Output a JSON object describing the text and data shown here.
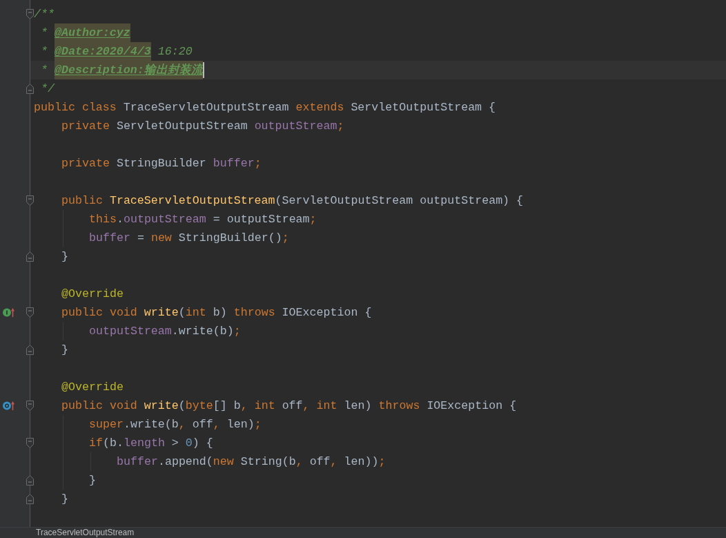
{
  "editor": {
    "lines": [
      {
        "current": false,
        "fold_marker": {
          "kind": "start"
        },
        "tokens": [
          {
            "kind": "doc",
            "text": "/**"
          }
        ]
      },
      {
        "current": false,
        "tokens": [
          {
            "kind": "doc",
            "text": " * "
          },
          {
            "kind": "doctag",
            "text": "@Author:cyz"
          }
        ]
      },
      {
        "current": false,
        "tokens": [
          {
            "kind": "doc",
            "text": " * "
          },
          {
            "kind": "doctag",
            "text": "@Date:2020/4/3"
          },
          {
            "kind": "doc",
            "text": " 16:20"
          }
        ]
      },
      {
        "current": true,
        "tokens": [
          {
            "kind": "doc",
            "text": " * "
          },
          {
            "kind": "doctag",
            "text": "@Description:输出封装流"
          }
        ]
      },
      {
        "current": false,
        "fold_marker": {
          "kind": "end"
        },
        "tokens": [
          {
            "kind": "doc",
            "text": " */"
          }
        ]
      },
      {
        "current": false,
        "tokens": [
          {
            "kind": "keyword",
            "text": "public class "
          },
          {
            "kind": "plain",
            "text": "TraceServletOutputStream "
          },
          {
            "kind": "keyword",
            "text": "extends "
          },
          {
            "kind": "plain",
            "text": "ServletOutputStream {"
          }
        ],
        "children": [
          {
            "current": false,
            "tokens": [
              {
                "kind": "keyword",
                "text": "private "
              },
              {
                "kind": "plain",
                "text": "ServletOutputStream "
              },
              {
                "kind": "field",
                "text": "outputStream"
              },
              {
                "kind": "punct",
                "text": ";"
              }
            ]
          },
          {
            "current": false
          },
          {
            "current": false,
            "tokens": [
              {
                "kind": "keyword",
                "text": "private "
              },
              {
                "kind": "plain",
                "text": "StringBuilder "
              },
              {
                "kind": "field",
                "text": "buffer"
              },
              {
                "kind": "punct",
                "text": ";"
              }
            ]
          },
          {
            "current": false
          },
          {
            "current": false,
            "fold_marker": {
              "kind": "start"
            },
            "tokens": [
              {
                "kind": "keyword",
                "text": "public "
              },
              {
                "kind": "decl",
                "text": "TraceServletOutputStream"
              },
              {
                "kind": "plain",
                "text": "(ServletOutputStream outputStream) {"
              }
            ],
            "children": [
              {
                "current": false,
                "tokens": [
                  {
                    "kind": "keyword",
                    "text": "this"
                  },
                  {
                    "kind": "plain",
                    "text": "."
                  },
                  {
                    "kind": "field",
                    "text": "outputStream"
                  },
                  {
                    "kind": "plain",
                    "text": " = outputStream"
                  },
                  {
                    "kind": "punct",
                    "text": ";"
                  }
                ]
              },
              {
                "current": false,
                "tokens": [
                  {
                    "kind": "field",
                    "text": "buffer"
                  },
                  {
                    "kind": "plain",
                    "text": " = "
                  },
                  {
                    "kind": "keyword",
                    "text": "new "
                  },
                  {
                    "kind": "plain",
                    "text": "StringBuilder()"
                  },
                  {
                    "kind": "punct",
                    "text": ";"
                  }
                ]
              }
            ]
          },
          {
            "current": false,
            "fold_marker": {
              "kind": "end"
            },
            "tokens": [
              {
                "kind": "plain",
                "text": "}"
              }
            ]
          },
          {
            "current": false
          },
          {
            "current": false,
            "tokens": [
              {
                "kind": "annotation",
                "text": "@Override"
              }
            ]
          },
          {
            "current": false,
            "gutter_icon": {
              "kind": "implements"
            },
            "fold_marker": {
              "kind": "start"
            },
            "tokens": [
              {
                "kind": "keyword",
                "text": "public void "
              },
              {
                "kind": "decl",
                "text": "write"
              },
              {
                "kind": "plain",
                "text": "("
              },
              {
                "kind": "keyword",
                "text": "int "
              },
              {
                "kind": "plain",
                "text": "b) "
              },
              {
                "kind": "keyword",
                "text": "throws "
              },
              {
                "kind": "plain",
                "text": "IOException {"
              }
            ],
            "children": [
              {
                "current": false,
                "tokens": [
                  {
                    "kind": "field",
                    "text": "outputStream"
                  },
                  {
                    "kind": "plain",
                    "text": ".write(b)"
                  },
                  {
                    "kind": "punct",
                    "text": ";"
                  }
                ]
              }
            ]
          },
          {
            "current": false,
            "fold_marker": {
              "kind": "end"
            },
            "tokens": [
              {
                "kind": "plain",
                "text": "}"
              }
            ]
          },
          {
            "current": false
          },
          {
            "current": false,
            "tokens": [
              {
                "kind": "annotation",
                "text": "@Override"
              }
            ]
          },
          {
            "current": false,
            "gutter_icon": {
              "kind": "overrides"
            },
            "fold_marker": {
              "kind": "start"
            },
            "tokens": [
              {
                "kind": "keyword",
                "text": "public void "
              },
              {
                "kind": "decl",
                "text": "write"
              },
              {
                "kind": "plain",
                "text": "("
              },
              {
                "kind": "keyword",
                "text": "byte"
              },
              {
                "kind": "plain",
                "text": "[] b"
              },
              {
                "kind": "punct",
                "text": ", "
              },
              {
                "kind": "keyword",
                "text": "int "
              },
              {
                "kind": "plain",
                "text": "off"
              },
              {
                "kind": "punct",
                "text": ", "
              },
              {
                "kind": "keyword",
                "text": "int "
              },
              {
                "kind": "plain",
                "text": "len) "
              },
              {
                "kind": "keyword",
                "text": "throws "
              },
              {
                "kind": "plain",
                "text": "IOException {"
              }
            ],
            "children": [
              {
                "current": false,
                "tokens": [
                  {
                    "kind": "keyword",
                    "text": "super"
                  },
                  {
                    "kind": "plain",
                    "text": ".write(b"
                  },
                  {
                    "kind": "punct",
                    "text": ", "
                  },
                  {
                    "kind": "plain",
                    "text": "off"
                  },
                  {
                    "kind": "punct",
                    "text": ", "
                  },
                  {
                    "kind": "plain",
                    "text": "len)"
                  },
                  {
                    "kind": "punct",
                    "text": ";"
                  }
                ]
              },
              {
                "current": false,
                "fold_marker": {
                  "kind": "start"
                },
                "tokens": [
                  {
                    "kind": "keyword",
                    "text": "if"
                  },
                  {
                    "kind": "plain",
                    "text": "(b."
                  },
                  {
                    "kind": "field",
                    "text": "length"
                  },
                  {
                    "kind": "plain",
                    "text": " > "
                  },
                  {
                    "kind": "number",
                    "text": "0"
                  },
                  {
                    "kind": "plain",
                    "text": ") {"
                  }
                ],
                "children": [
                  {
                    "current": false,
                    "tokens": [
                      {
                        "kind": "field",
                        "text": "buffer"
                      },
                      {
                        "kind": "plain",
                        "text": ".append("
                      },
                      {
                        "kind": "keyword",
                        "text": "new "
                      },
                      {
                        "kind": "plain",
                        "text": "String(b"
                      },
                      {
                        "kind": "punct",
                        "text": ", "
                      },
                      {
                        "kind": "plain",
                        "text": "off"
                      },
                      {
                        "kind": "punct",
                        "text": ", "
                      },
                      {
                        "kind": "plain",
                        "text": "len))"
                      },
                      {
                        "kind": "punct",
                        "text": ";"
                      }
                    ]
                  }
                ]
              },
              {
                "current": false,
                "fold_marker": {
                  "kind": "end"
                },
                "tokens": [
                  {
                    "kind": "plain",
                    "text": "}"
                  }
                ]
              }
            ]
          },
          {
            "current": false,
            "fold_marker": {
              "kind": "end"
            },
            "tokens": [
              {
                "kind": "plain",
                "text": "}"
              }
            ]
          },
          {
            "current": false
          }
        ]
      }
    ]
  },
  "breadcrumb": {
    "items": [
      "TraceServletOutputStream"
    ]
  }
}
